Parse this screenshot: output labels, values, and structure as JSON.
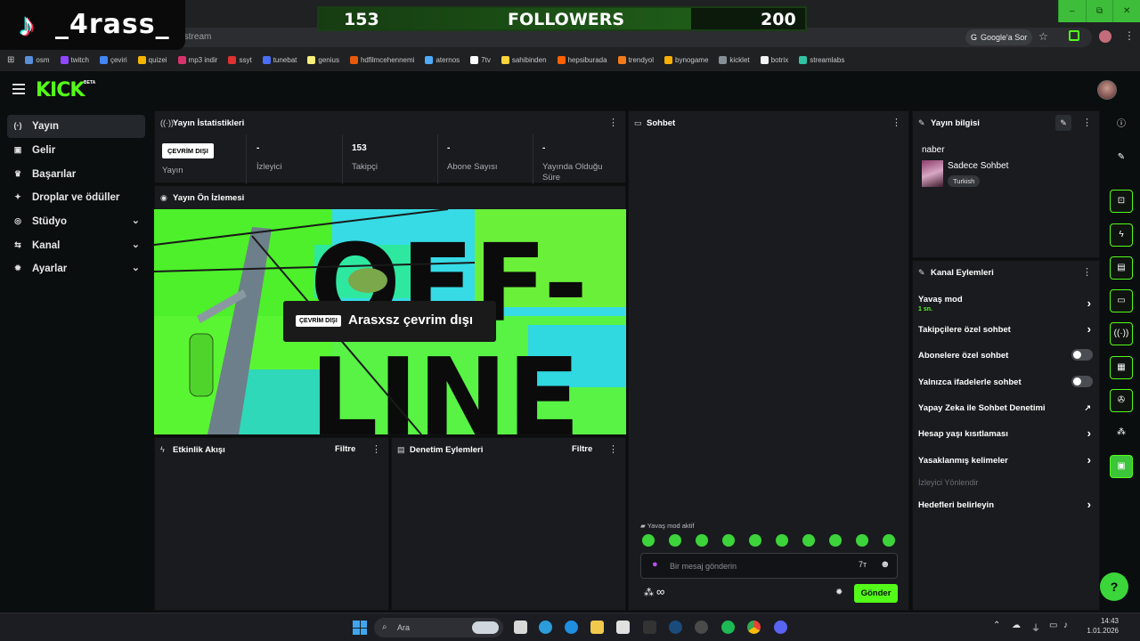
{
  "overlay": {
    "tiktok_handle": "_4rass_",
    "followers": {
      "current": "153",
      "label": "FOLLOWERS",
      "goal": "200",
      "progress": 0.765
    }
  },
  "browser": {
    "url": "/stream",
    "google_sor": "Google'a Sor",
    "bookmarks": [
      {
        "label": "osm",
        "color": "#5a8fd8"
      },
      {
        "label": "twitch",
        "color": "#9146ff"
      },
      {
        "label": "çeviri",
        "color": "#4285f4"
      },
      {
        "label": "quizei",
        "color": "#f4b400"
      },
      {
        "label": "mp3 indir",
        "color": "#d6336c"
      },
      {
        "label": "ssyt",
        "color": "#e03131"
      },
      {
        "label": "tunebat",
        "color": "#4c6ef5"
      },
      {
        "label": "genius",
        "color": "#f7f07a"
      },
      {
        "label": "hdfilmcehennemi",
        "color": "#e8590c"
      },
      {
        "label": "aternos",
        "color": "#4dabf7"
      },
      {
        "label": "7tv",
        "color": "#ffffff"
      },
      {
        "label": "sahibinden",
        "color": "#ffd43b"
      },
      {
        "label": "hepsiburada",
        "color": "#ff6000"
      },
      {
        "label": "trendyol",
        "color": "#f27a1a"
      },
      {
        "label": "bynogame",
        "color": "#fab005"
      },
      {
        "label": "kicklet",
        "color": "#868e96"
      },
      {
        "label": "botrix",
        "color": "#f1f3f5"
      },
      {
        "label": "streamlabs",
        "color": "#31c3a2"
      }
    ],
    "window_controls": [
      "–",
      "⧉",
      "✕"
    ]
  },
  "kick": {
    "logo": "KICK",
    "beta": "BETA"
  },
  "sidebar": {
    "items": [
      {
        "label": "Yayın",
        "icon": "(·)"
      },
      {
        "label": "Gelir",
        "icon": "▣"
      },
      {
        "label": "Başarılar",
        "icon": "♛"
      },
      {
        "label": "Droplar ve ödüller",
        "icon": "✦"
      },
      {
        "label": "Stüdyo",
        "icon": "◎",
        "chevron": "⌄"
      },
      {
        "label": "Kanal",
        "icon": "⇆",
        "chevron": "⌄"
      },
      {
        "label": "Ayarlar",
        "icon": "✹",
        "chevron": "⌄"
      }
    ]
  },
  "stats_panel": {
    "title": "Yayın İstatistikleri",
    "offline_badge": "ÇEVRİM DIŞI",
    "stats": [
      {
        "value": "",
        "label": "Yayın"
      },
      {
        "value": "-",
        "label": "İzleyici"
      },
      {
        "value": "153",
        "label": "Takipçi"
      },
      {
        "value": "-",
        "label": "Abone Sayısı"
      },
      {
        "value": "-",
        "label": "Yayında Olduğu Süre"
      }
    ]
  },
  "preview_panel": {
    "title": "Yayın Ön İzlemesi",
    "art_text_top": "OFF-",
    "art_text_bottom": "LINE",
    "offline_chip": "ÇEVRİM DIŞI",
    "offline_message": "Arasxsz çevrim dışı"
  },
  "activity_panel": {
    "title": "Etkinlik Akışı",
    "filter": "Filtre"
  },
  "mod_panel": {
    "title": "Denetim Eylemleri",
    "filter": "Filtre"
  },
  "chat_panel": {
    "title": "Sohbet",
    "slow_mode_notice": "Yavaş mod aktif",
    "input_placeholder": "Bir mesaj gönderin",
    "send_label": "Gönder",
    "infinity": "∞",
    "emotes": 10
  },
  "stream_info": {
    "title": "Yayın bilgisi",
    "stream_title": "naber",
    "category": "Sadece Sohbet",
    "language_tag": "Turkish"
  },
  "channel_actions": {
    "title": "Kanal Eylemleri",
    "items": [
      {
        "label": "Yavaş mod",
        "sub": "1 sn.",
        "control": "arrow"
      },
      {
        "label": "Takipçilere özel sohbet",
        "control": "arrow"
      },
      {
        "label": "Abonelere özel sohbet",
        "control": "toggle"
      },
      {
        "label": "Yalnızca ifadelerle sohbet",
        "control": "toggle"
      },
      {
        "label": "Yapay Zeka ile Sohbet Denetimi",
        "control": "external"
      },
      {
        "label": "Hesap yaşı kısıtlaması",
        "control": "arrow"
      },
      {
        "label": "Yasaklanmış kelimeler",
        "control": "arrow"
      },
      {
        "label": "İzleyici Yönlendir",
        "control": "none",
        "disabled": true
      },
      {
        "label": "Hedefleri belirleyin",
        "control": "arrow"
      }
    ]
  },
  "right_rail": [
    "info-icon",
    "edit-icon",
    "scan-icon",
    "bolt-icon",
    "doc-icon",
    "chat-icon",
    "broadcast-icon",
    "layers-icon",
    "wrench-icon",
    "dots-icon",
    "app-icon"
  ],
  "taskbar": {
    "search": "Ara",
    "time": "14:43",
    "date": "1.01.2026"
  }
}
